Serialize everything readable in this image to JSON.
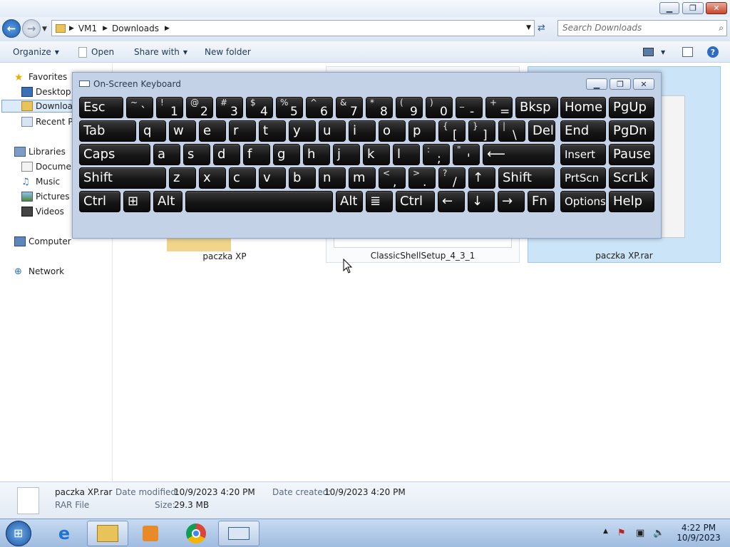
{
  "window": {
    "caption_buttons": {
      "minimize_icon": "minimize-icon",
      "maximize_icon": "restore-icon",
      "close_icon": "close-icon"
    }
  },
  "address": {
    "crumbs": [
      "VM1",
      "Downloads"
    ],
    "search_placeholder": "Search Downloads"
  },
  "toolbar": {
    "organize": "Organize",
    "open": "Open",
    "share_with": "Share with",
    "new_folder": "New folder"
  },
  "nav": {
    "favorites": "Favorites",
    "desktop": "Desktop",
    "downloads": "Downloads",
    "recent_places": "Recent Places",
    "libraries": "Libraries",
    "documents": "Documents",
    "music": "Music",
    "pictures": "Pictures",
    "videos": "Videos",
    "computer": "Computer",
    "network": "Network"
  },
  "files": [
    {
      "name": "paczka XP"
    },
    {
      "name": "ClassicShellSetup_4_3_1"
    },
    {
      "name": "paczka XP.rar"
    }
  ],
  "details": {
    "name": "paczka XP.rar",
    "type": "RAR File",
    "date_modified_label": "Date modified:",
    "date_modified": "10/9/2023 4:20 PM",
    "date_created_label": "Date created:",
    "date_created": "10/9/2023 4:20 PM",
    "size_label": "Size:",
    "size": "29.3 MB"
  },
  "osk": {
    "title": "On-Screen Keyboard",
    "row1": [
      {
        "m": "Esc"
      },
      {
        "s": "~",
        "b": "`"
      },
      {
        "s": "!",
        "b": "1"
      },
      {
        "s": "@",
        "b": "2"
      },
      {
        "s": "#",
        "b": "3"
      },
      {
        "s": "$",
        "b": "4"
      },
      {
        "s": "%",
        "b": "5"
      },
      {
        "s": "^",
        "b": "6"
      },
      {
        "s": "&",
        "b": "7"
      },
      {
        "s": "*",
        "b": "8"
      },
      {
        "s": "(",
        "b": "9"
      },
      {
        "s": ")",
        "b": "0"
      },
      {
        "s": "_",
        "b": "-"
      },
      {
        "s": "+",
        "b": "="
      },
      {
        "m": "Bksp"
      },
      {
        "m": "Home"
      },
      {
        "m": "PgUp"
      }
    ],
    "row2": [
      {
        "m": "Tab"
      },
      {
        "m": "q"
      },
      {
        "m": "w"
      },
      {
        "m": "e"
      },
      {
        "m": "r"
      },
      {
        "m": "t"
      },
      {
        "m": "y"
      },
      {
        "m": "u"
      },
      {
        "m": "i"
      },
      {
        "m": "o"
      },
      {
        "m": "p"
      },
      {
        "s": "{",
        "b": "["
      },
      {
        "s": "}",
        "b": "]"
      },
      {
        "s": "|",
        "b": "\\"
      },
      {
        "m": "Del"
      },
      {
        "m": "End"
      },
      {
        "m": "PgDn"
      }
    ],
    "row3": [
      {
        "m": "Caps"
      },
      {
        "m": "a"
      },
      {
        "m": "s"
      },
      {
        "m": "d"
      },
      {
        "m": "f"
      },
      {
        "m": "g"
      },
      {
        "m": "h"
      },
      {
        "m": "j"
      },
      {
        "m": "k"
      },
      {
        "m": "l"
      },
      {
        "s": ":",
        "b": ";"
      },
      {
        "s": "\"",
        "b": "'"
      },
      {
        "m": "⟵",
        "icon": "enter-arrow-icon"
      },
      {
        "m": "Insert"
      },
      {
        "m": "Pause"
      }
    ],
    "row4": [
      {
        "m": "Shift"
      },
      {
        "m": "z"
      },
      {
        "m": "x"
      },
      {
        "m": "c"
      },
      {
        "m": "v"
      },
      {
        "m": "b"
      },
      {
        "m": "n"
      },
      {
        "m": "m"
      },
      {
        "s": "<",
        "b": ","
      },
      {
        "s": ">",
        "b": "."
      },
      {
        "s": "?",
        "b": "/"
      },
      {
        "m": "↑"
      },
      {
        "m": "Shift"
      },
      {
        "m": "PrtScn"
      },
      {
        "m": "ScrLk"
      }
    ],
    "row5": [
      {
        "m": "Ctrl"
      },
      {
        "m": "⊞",
        "icon": "windows-logo-icon"
      },
      {
        "m": "Alt"
      },
      {
        "m": "",
        "icon": "space-key"
      },
      {
        "m": "Alt"
      },
      {
        "m": "≣",
        "icon": "menu-key-icon"
      },
      {
        "m": "Ctrl"
      },
      {
        "m": "←"
      },
      {
        "m": "↓"
      },
      {
        "m": "→"
      },
      {
        "m": "Fn"
      },
      {
        "m": "Options"
      },
      {
        "m": "Help"
      }
    ]
  },
  "taskbar": {
    "time": "4:22 PM",
    "date": "10/9/2023"
  }
}
